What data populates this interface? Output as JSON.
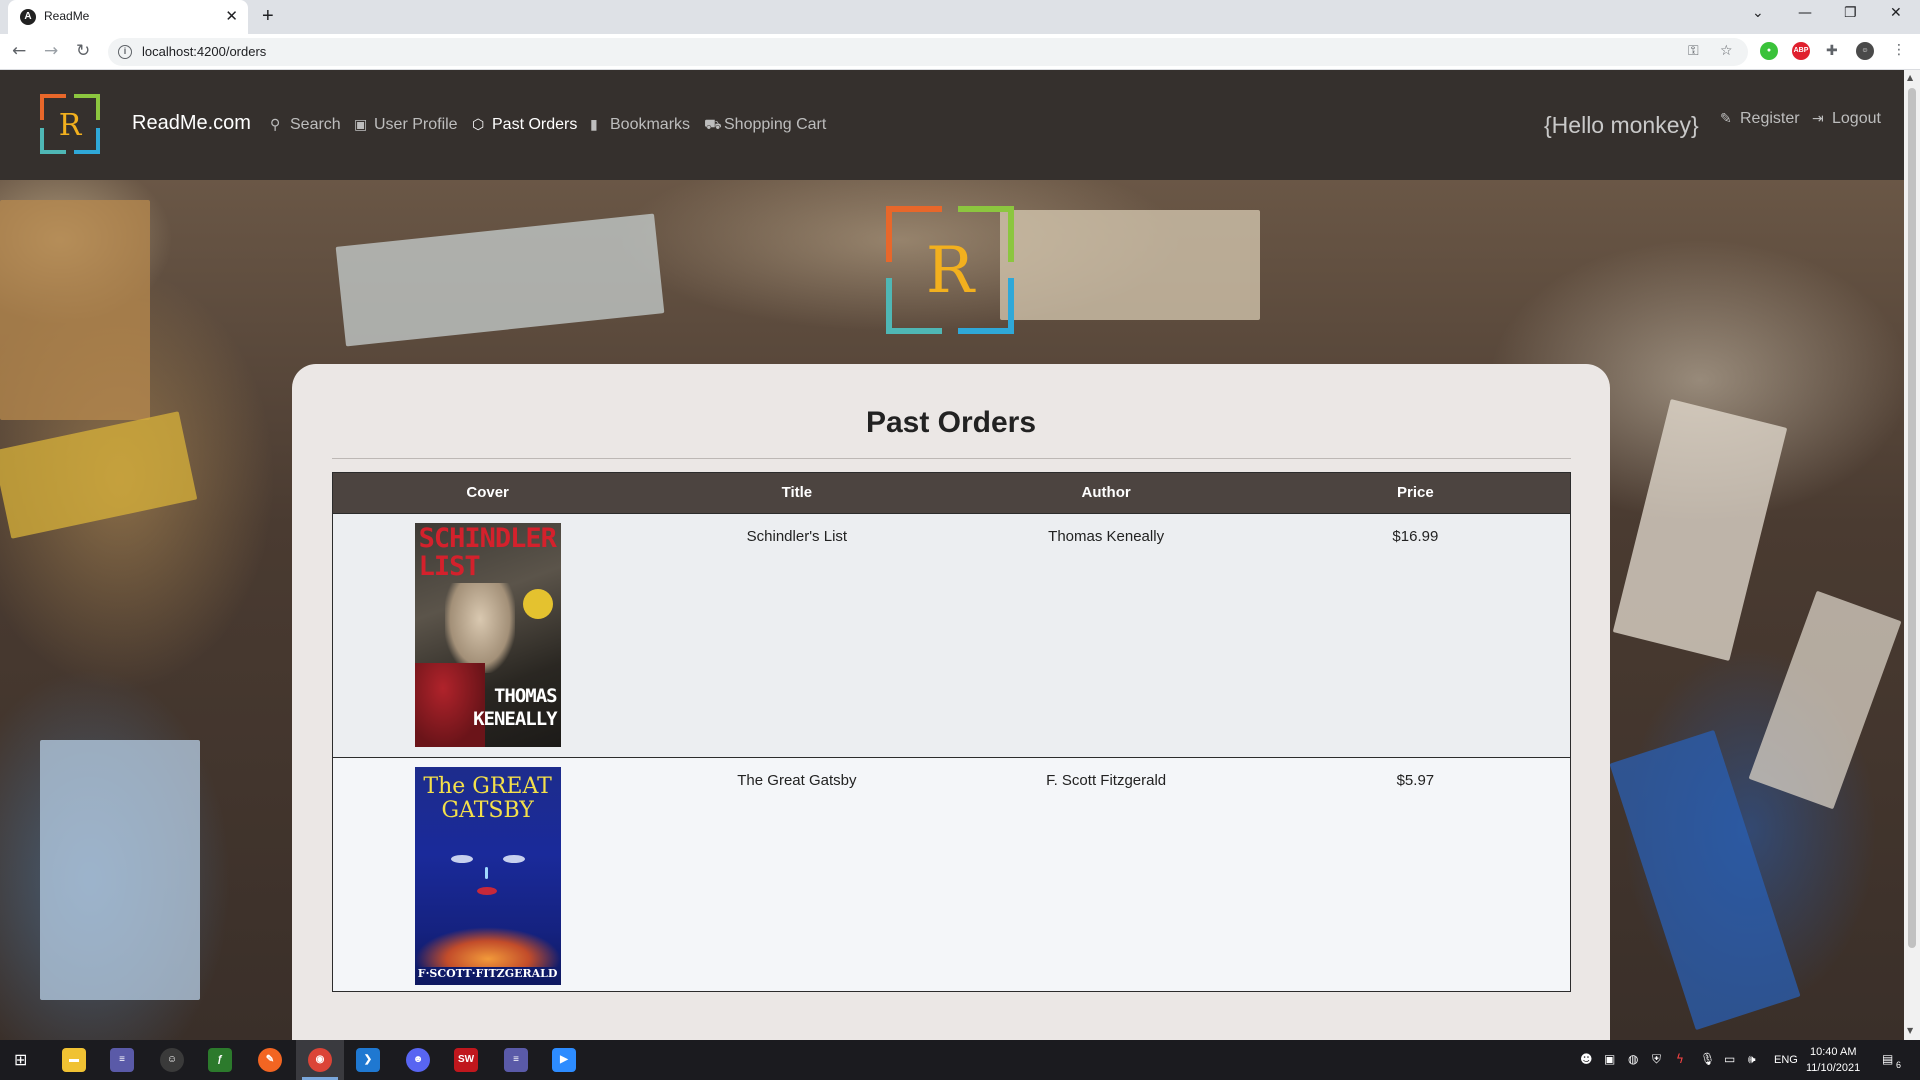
{
  "browser": {
    "tab_title": "ReadMe",
    "tab_icon": "A",
    "url": "localhost:4200/orders"
  },
  "site": {
    "brand": "ReadMe.com",
    "logo_letter": "R",
    "nav": [
      {
        "label": "Search",
        "icon": "search-icon"
      },
      {
        "label": "User Profile",
        "icon": "user-profile-icon"
      },
      {
        "label": "Past Orders",
        "icon": "box-icon"
      },
      {
        "label": "Bookmarks",
        "icon": "bookmark-icon"
      },
      {
        "label": "Shopping Cart",
        "icon": "cart-icon"
      }
    ],
    "greeting": "{Hello monkey}",
    "register_label": "Register",
    "logout_label": "Logout"
  },
  "orders": {
    "heading": "Past Orders",
    "columns": [
      "Cover",
      "Title",
      "Author",
      "Price"
    ],
    "rows": [
      {
        "title": "Schindler's List",
        "author": "Thomas Keneally",
        "price": "$16.99",
        "cover_title_lines": [
          "SCHINDLER'S",
          "LIST"
        ],
        "cover_author_lines": [
          "THOMAS",
          "KENEALLY"
        ]
      },
      {
        "title": "The Great Gatsby",
        "author": "F. Scott Fitzgerald",
        "price": "$5.97",
        "cover_title_lines": [
          "The GREAT",
          "GATSBY"
        ],
        "cover_author_line": "F·SCOTT·FITZGERALD"
      }
    ]
  },
  "taskbar": {
    "language": "ENG",
    "time": "10:40 AM",
    "date": "11/10/2021",
    "notification_count": "6"
  },
  "colors": {
    "navbar": "#35302d",
    "table_header": "#4c4440",
    "card": "#ebe7e5",
    "logo_orange": "#e8672a",
    "logo_green": "#8cc63f",
    "logo_teal": "#4fb7b5",
    "logo_blue": "#2fa8d8",
    "logo_letter": "#f2b01e"
  }
}
